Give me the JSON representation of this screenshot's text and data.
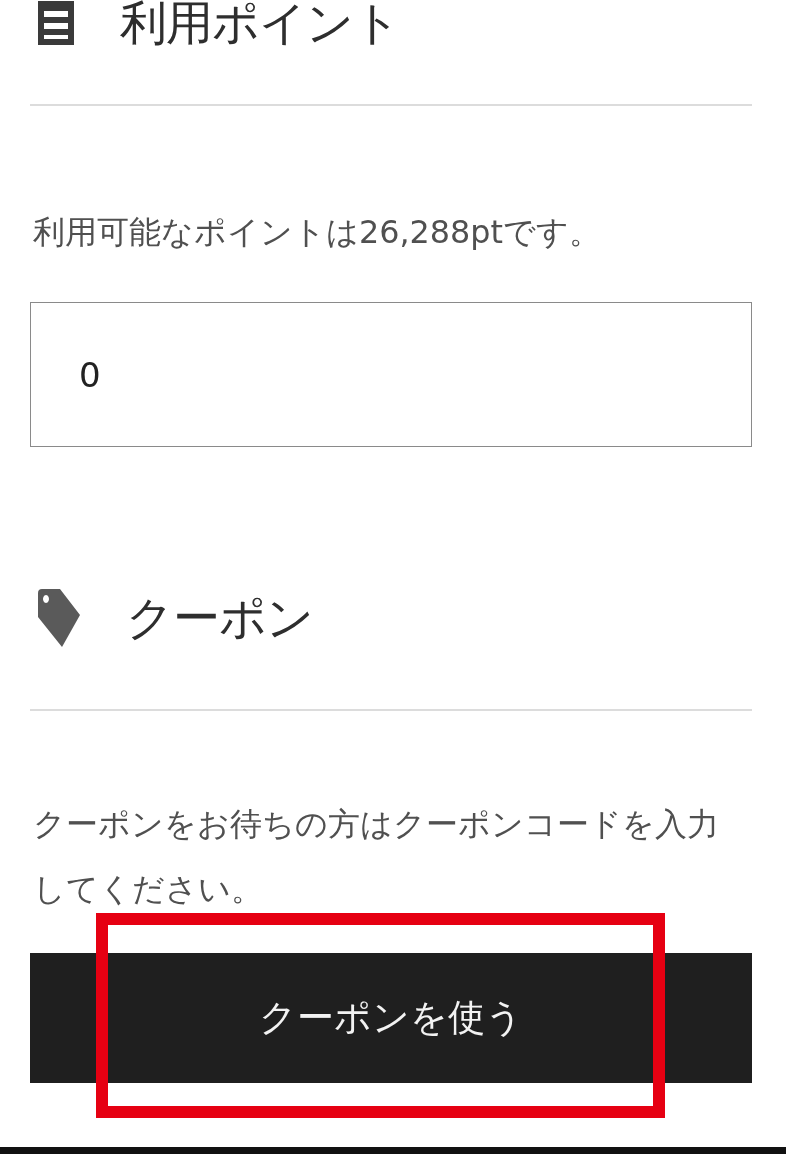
{
  "points_section": {
    "title": "利用ポイント",
    "available_text": "利用可能なポイントは26,288ptです。",
    "points_input": {
      "value": "0"
    }
  },
  "coupon_section": {
    "title": "クーポン",
    "instructions": "クーポンをお待ちの方はクーポンコードを入力してください。",
    "use_coupon_button": {
      "label": "クーポンを使う",
      "highlighted": true
    }
  }
}
